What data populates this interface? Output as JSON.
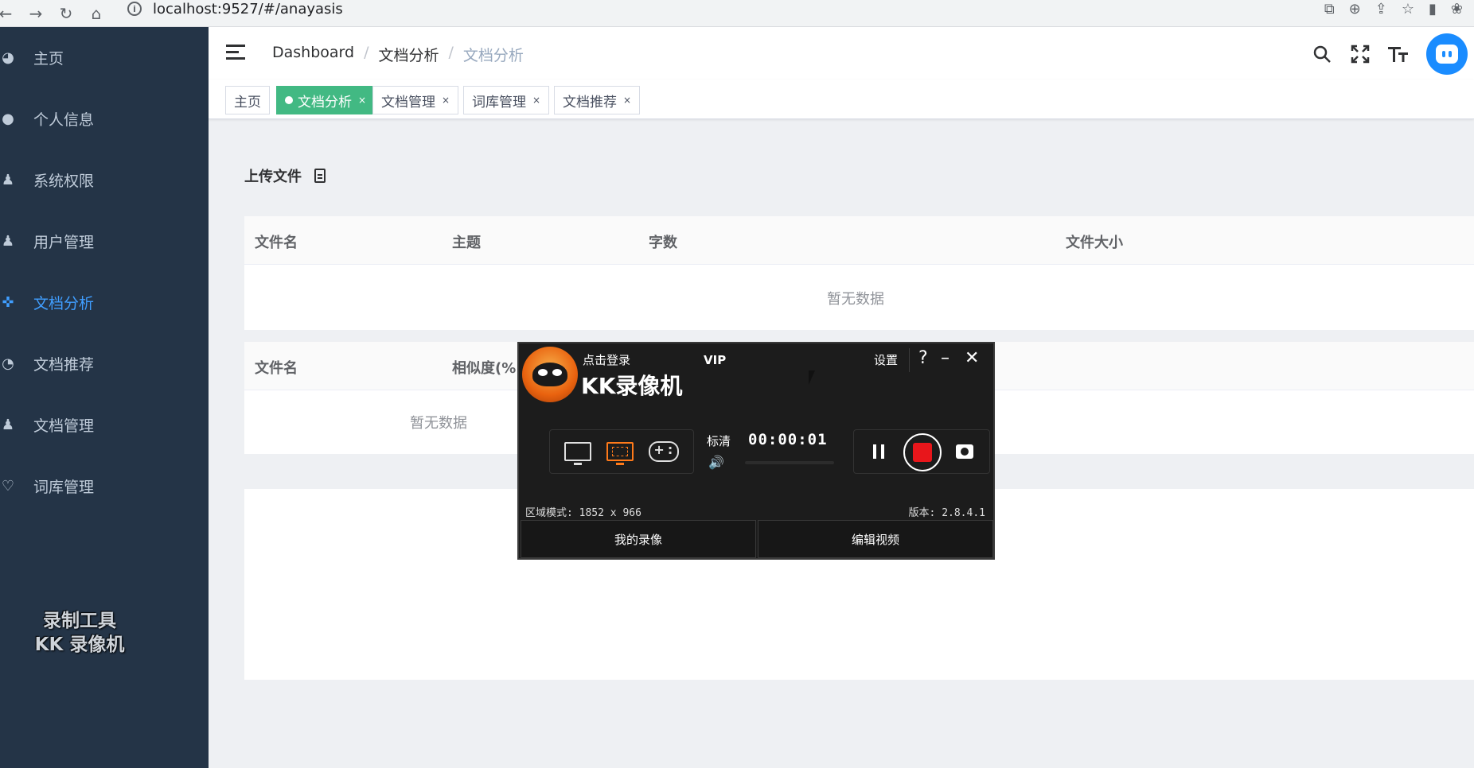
{
  "browser": {
    "url": "localhost:9527/#/anayasis",
    "back_icon": "arrow-left-icon",
    "forward_icon": "arrow-right-icon",
    "reload_icon": "reload-icon",
    "home_icon": "home-icon"
  },
  "sidebar": {
    "items": [
      {
        "label": "主页",
        "icon": "dashboard-icon",
        "active": false
      },
      {
        "label": "个人信息",
        "icon": "user-icon",
        "active": false
      },
      {
        "label": "系统权限",
        "icon": "permission-icon",
        "active": false
      },
      {
        "label": "用户管理",
        "icon": "users-icon",
        "active": false
      },
      {
        "label": "文档分析",
        "icon": "analysis-icon",
        "active": true
      },
      {
        "label": "文档推荐",
        "icon": "recommend-icon",
        "active": false
      },
      {
        "label": "文档管理",
        "icon": "document-manage-icon",
        "active": false
      },
      {
        "label": "词库管理",
        "icon": "lexicon-icon",
        "active": false
      }
    ],
    "watermark_line1": "录制工具",
    "watermark_line2": "KK 录像机",
    "active_color": "#409eff",
    "background": "#243447"
  },
  "header": {
    "breadcrumb": [
      "Dashboard",
      "文档分析",
      "文档分析"
    ]
  },
  "tags": [
    {
      "label": "主页",
      "active": false,
      "closable": false
    },
    {
      "label": "文档分析",
      "active": true,
      "closable": true
    },
    {
      "label": "文档管理",
      "active": false,
      "closable": true
    },
    {
      "label": "词库管理",
      "active": false,
      "closable": true
    },
    {
      "label": "文档推荐",
      "active": false,
      "closable": true
    }
  ],
  "tag_close": "×",
  "main": {
    "upload_label": "上传文件",
    "table1": {
      "headers": [
        "文件名",
        "主题",
        "字数",
        "文件大小"
      ],
      "empty_text": "暂无数据"
    },
    "table2": {
      "headers": [
        "文件名",
        "相似度(%"
      ],
      "empty_text": "暂无数据"
    }
  },
  "recorder": {
    "login": "点击登录",
    "vip": "VIP",
    "title": "KK录像机",
    "settings": "设置",
    "help": "?",
    "minimize": "–",
    "close": "✕",
    "quality": "标清",
    "time": "00:00:01",
    "speaker": "🔊",
    "mode_text": "区域模式: 1852 x 966",
    "version_text": "版本: 2.8.4.1",
    "my_recordings": "我的录像",
    "edit_video": "编辑视频",
    "record_color": "#e8161b",
    "accent": "#ff7a1a"
  }
}
